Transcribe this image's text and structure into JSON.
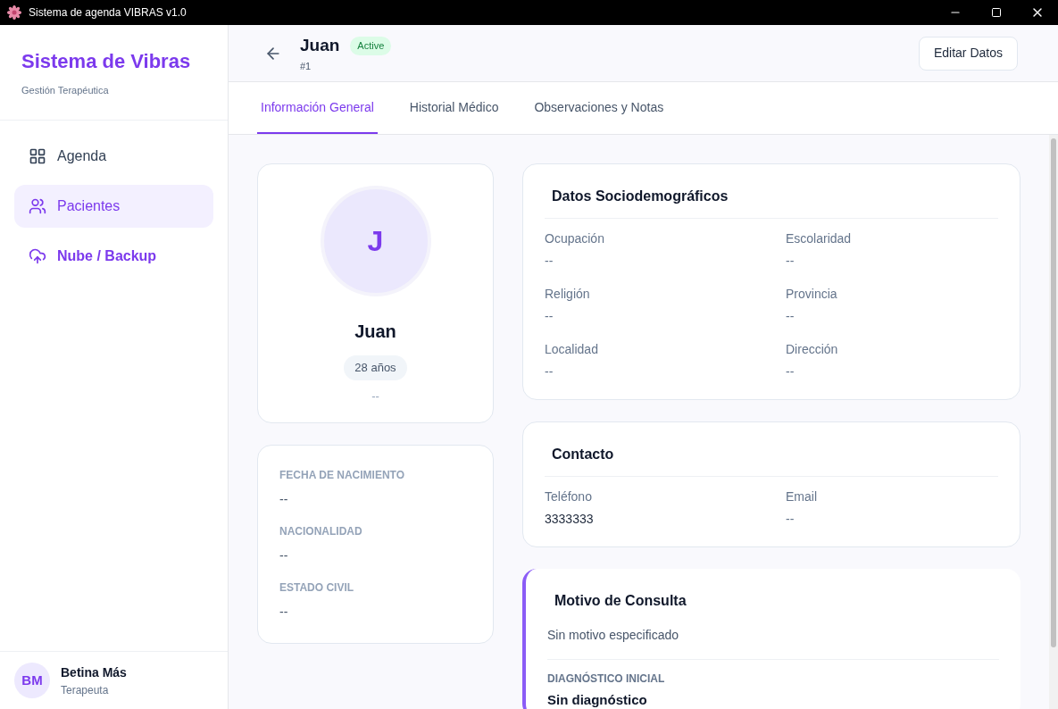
{
  "window": {
    "title": "Sistema de agenda VIBRAS v1.0"
  },
  "sidebar": {
    "brand": "Sistema de Vibras",
    "subtitle": "Gestión Terapéutica",
    "items": [
      {
        "label": "Agenda",
        "kind": "grid",
        "selected": false
      },
      {
        "label": "Pacientes",
        "kind": "users",
        "selected": true
      },
      {
        "label": "Nube / Backup",
        "kind": "cloud",
        "selected": false
      }
    ],
    "user": {
      "initials": "BM",
      "name": "Betina Más",
      "role": "Terapeuta"
    }
  },
  "header": {
    "name": "Juan",
    "status": "Active",
    "id": "#1",
    "edit_button": "Editar Datos"
  },
  "tabs": [
    {
      "label": "Información General",
      "selected": true
    },
    {
      "label": "Historial Médico",
      "selected": false
    },
    {
      "label": "Observaciones y Notas",
      "selected": false
    }
  ],
  "profile": {
    "initial": "J",
    "name": "Juan",
    "age": "28 años",
    "extra": "--"
  },
  "personal": [
    {
      "label": "FECHA DE NACIMIENTO",
      "value": "--"
    },
    {
      "label": "NACIONALIDAD",
      "value": "--"
    },
    {
      "label": "ESTADO CIVIL",
      "value": "--"
    }
  ],
  "sociodemographic": {
    "title": "Datos Sociodemográficos",
    "fields": [
      {
        "label": "Ocupación",
        "value": "--"
      },
      {
        "label": "Escolaridad",
        "value": "--"
      },
      {
        "label": "Religión",
        "value": "--"
      },
      {
        "label": "Provincia",
        "value": "--"
      },
      {
        "label": "Localidad",
        "value": "--"
      },
      {
        "label": "Dirección",
        "value": "--"
      }
    ]
  },
  "contact": {
    "title": "Contacto",
    "fields": [
      {
        "label": "Teléfono",
        "value": "3333333"
      },
      {
        "label": "Email",
        "value": "--"
      }
    ]
  },
  "consultation": {
    "title": "Motivo de Consulta",
    "reason": "Sin motivo especificado",
    "diagnosis_label": "DIAGNÓSTICO INICIAL",
    "diagnosis": "Sin diagnóstico"
  }
}
